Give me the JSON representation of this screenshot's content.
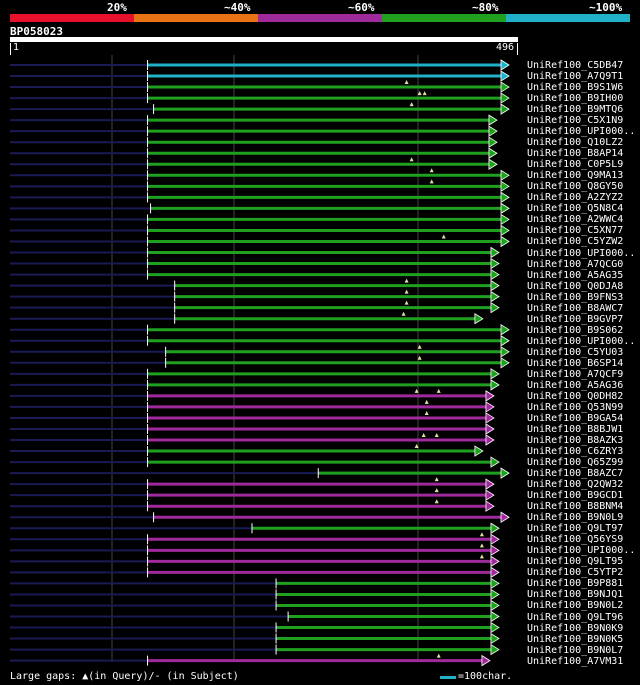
{
  "scale": {
    "segments": [
      "#e8112d",
      "#e87314",
      "#9f2a9b",
      "#1fa01f",
      "#20b0c8"
    ],
    "labels": [
      "20%",
      "~40%",
      "~60%",
      "~80%",
      "~100%"
    ]
  },
  "query": {
    "name": "BP058023",
    "start": "1",
    "end": "496",
    "length": 496
  },
  "colors": {
    "100": "#20b0c8",
    "80": "#1fa01f",
    "60": "#9f2a9b",
    "gap": "#1a1a55",
    "marker": "#e0e0a0"
  },
  "hits": [
    {
      "label": "UniRef100_C5DB47",
      "start": 137,
      "end": 496,
      "identity": "100",
      "arrow": true,
      "gaps": []
    },
    {
      "label": "UniRef100_A7Q9T1",
      "start": 137,
      "end": 496,
      "identity": "100",
      "arrow": true,
      "gaps": []
    },
    {
      "label": "UniRef100_B9S1W6",
      "start": 137,
      "end": 496,
      "identity": "80",
      "arrow": true,
      "gaps": [
        395
      ]
    },
    {
      "label": "UniRef100_B9IH00",
      "start": 137,
      "end": 496,
      "identity": "80",
      "arrow": true,
      "gaps": [
        408,
        413
      ]
    },
    {
      "label": "UniRef100_B9MTQ6",
      "start": 143,
      "end": 496,
      "identity": "80",
      "arrow": true,
      "gaps": [
        400
      ]
    },
    {
      "label": "UniRef100_C5X1N9",
      "start": 137,
      "end": 484,
      "identity": "80",
      "arrow": true,
      "gaps": []
    },
    {
      "label": "UniRef100_UPI000..",
      "start": 137,
      "end": 484,
      "identity": "80",
      "arrow": true,
      "gaps": []
    },
    {
      "label": "UniRef100_Q10LZ2",
      "start": 137,
      "end": 484,
      "identity": "80",
      "arrow": true,
      "gaps": []
    },
    {
      "label": "UniRef100_B8AP14",
      "start": 137,
      "end": 484,
      "identity": "80",
      "arrow": true,
      "gaps": []
    },
    {
      "label": "UniRef100_C0P5L9",
      "start": 137,
      "end": 484,
      "identity": "80",
      "arrow": true,
      "gaps": [
        400
      ]
    },
    {
      "label": "UniRef100_Q9MA13",
      "start": 137,
      "end": 496,
      "identity": "80",
      "arrow": true,
      "gaps": [
        420
      ]
    },
    {
      "label": "UniRef100_Q8GY50",
      "start": 137,
      "end": 496,
      "identity": "80",
      "arrow": true,
      "gaps": [
        420
      ]
    },
    {
      "label": "UniRef100_A2ZYZ2",
      "start": 137,
      "end": 496,
      "identity": "80",
      "arrow": true,
      "gaps": []
    },
    {
      "label": "UniRef100_Q5N8C4",
      "start": 140,
      "end": 496,
      "identity": "80",
      "arrow": true,
      "gaps": []
    },
    {
      "label": "UniRef100_A2WWC4",
      "start": 137,
      "end": 496,
      "identity": "80",
      "arrow": true,
      "gaps": []
    },
    {
      "label": "UniRef100_C5XN77",
      "start": 137,
      "end": 496,
      "identity": "80",
      "arrow": true,
      "gaps": []
    },
    {
      "label": "UniRef100_C5YZW2",
      "start": 137,
      "end": 496,
      "identity": "80",
      "arrow": true,
      "gaps": [
        432
      ]
    },
    {
      "label": "UniRef100_UPI000..",
      "start": 137,
      "end": 486,
      "identity": "80",
      "arrow": true,
      "gaps": []
    },
    {
      "label": "UniRef100_A7QCG0",
      "start": 137,
      "end": 486,
      "identity": "80",
      "arrow": true,
      "gaps": []
    },
    {
      "label": "UniRef100_A5AG35",
      "start": 137,
      "end": 486,
      "identity": "80",
      "arrow": true,
      "gaps": []
    },
    {
      "label": "UniRef100_Q0DJA8",
      "start": 164,
      "end": 486,
      "identity": "80",
      "arrow": true,
      "gaps": [
        395
      ]
    },
    {
      "label": "UniRef100_B9FNS3",
      "start": 164,
      "end": 486,
      "identity": "80",
      "arrow": true,
      "gaps": [
        395
      ]
    },
    {
      "label": "UniRef100_B8AWC7",
      "start": 164,
      "end": 486,
      "identity": "80",
      "arrow": true,
      "gaps": [
        395
      ]
    },
    {
      "label": "UniRef100_B9GVP7",
      "start": 164,
      "end": 470,
      "identity": "80",
      "arrow": true,
      "gaps": [
        392
      ]
    },
    {
      "label": "UniRef100_B9S062",
      "start": 137,
      "end": 496,
      "identity": "80",
      "arrow": true,
      "gaps": []
    },
    {
      "label": "UniRef100_UPI000..",
      "start": 137,
      "end": 496,
      "identity": "80",
      "arrow": true,
      "gaps": []
    },
    {
      "label": "UniRef100_C5YU03",
      "start": 155,
      "end": 496,
      "identity": "80",
      "arrow": true,
      "gaps": [
        408
      ]
    },
    {
      "label": "UniRef100_B6SP14",
      "start": 155,
      "end": 496,
      "identity": "80",
      "arrow": true,
      "gaps": [
        408
      ]
    },
    {
      "label": "UniRef100_A7QCF9",
      "start": 137,
      "end": 486,
      "identity": "80",
      "arrow": true,
      "gaps": []
    },
    {
      "label": "UniRef100_A5AG36",
      "start": 137,
      "end": 486,
      "identity": "80",
      "arrow": true,
      "gaps": []
    },
    {
      "label": "UniRef100_Q0DH82",
      "start": 137,
      "end": 481,
      "identity": "60",
      "arrow": true,
      "gaps": [
        405,
        427
      ]
    },
    {
      "label": "UniRef100_Q53N99",
      "start": 137,
      "end": 481,
      "identity": "60",
      "arrow": true,
      "gaps": [
        415
      ]
    },
    {
      "label": "UniRef100_B9GA54",
      "start": 137,
      "end": 481,
      "identity": "60",
      "arrow": true,
      "gaps": [
        415
      ]
    },
    {
      "label": "UniRef100_B8BJW1",
      "start": 137,
      "end": 481,
      "identity": "60",
      "arrow": true,
      "gaps": []
    },
    {
      "label": "UniRef100_B8AZK3",
      "start": 137,
      "end": 481,
      "identity": "60",
      "arrow": true,
      "gaps": [
        412,
        425
      ]
    },
    {
      "label": "UniRef100_C6ZRY3",
      "start": 137,
      "end": 470,
      "identity": "80",
      "arrow": true,
      "gaps": [
        405
      ]
    },
    {
      "label": "UniRef100_Q65Z99",
      "start": 137,
      "end": 486,
      "identity": "80",
      "arrow": true,
      "gaps": []
    },
    {
      "label": "UniRef100_B8AZC7",
      "start": 307,
      "end": 496,
      "identity": "80",
      "arrow": true,
      "gaps": []
    },
    {
      "label": "UniRef100_Q2QW32",
      "start": 137,
      "end": 481,
      "identity": "60",
      "arrow": true,
      "gaps": [
        425
      ]
    },
    {
      "label": "UniRef100_B9GCD1",
      "start": 137,
      "end": 481,
      "identity": "60",
      "arrow": true,
      "gaps": [
        425
      ]
    },
    {
      "label": "UniRef100_B8BNM4",
      "start": 137,
      "end": 481,
      "identity": "60",
      "arrow": true,
      "gaps": [
        425
      ]
    },
    {
      "label": "UniRef100_B9N0L9",
      "start": 143,
      "end": 496,
      "identity": "60",
      "arrow": true,
      "gaps": []
    },
    {
      "label": "UniRef100_Q9LT97",
      "start": 241,
      "end": 486,
      "identity": "80",
      "arrow": true,
      "gaps": []
    },
    {
      "label": "UniRef100_Q56YS9",
      "start": 137,
      "end": 486,
      "identity": "60",
      "arrow": true,
      "gaps": [
        470
      ]
    },
    {
      "label": "UniRef100_UPI000..",
      "start": 137,
      "end": 486,
      "identity": "60",
      "arrow": true,
      "gaps": [
        470
      ]
    },
    {
      "label": "UniRef100_Q9LT95",
      "start": 137,
      "end": 486,
      "identity": "60",
      "arrow": true,
      "gaps": [
        470
      ]
    },
    {
      "label": "UniRef100_C5YTP2",
      "start": 137,
      "end": 486,
      "identity": "60",
      "arrow": true,
      "gaps": []
    },
    {
      "label": "UniRef100_B9P881",
      "start": 265,
      "end": 486,
      "identity": "80",
      "arrow": true,
      "gaps": []
    },
    {
      "label": "UniRef100_B9NJQ1",
      "start": 265,
      "end": 486,
      "identity": "80",
      "arrow": true,
      "gaps": []
    },
    {
      "label": "UniRef100_B9N0L2",
      "start": 265,
      "end": 486,
      "identity": "80",
      "arrow": true,
      "gaps": []
    },
    {
      "label": "UniRef100_Q9LT96",
      "start": 277,
      "end": 486,
      "identity": "80",
      "arrow": true,
      "gaps": []
    },
    {
      "label": "UniRef100_B9N0K9",
      "start": 265,
      "end": 486,
      "identity": "80",
      "arrow": true,
      "gaps": []
    },
    {
      "label": "UniRef100_B9N0K5",
      "start": 265,
      "end": 486,
      "identity": "80",
      "arrow": true,
      "gaps": []
    },
    {
      "label": "UniRef100_B9N0L7",
      "start": 265,
      "end": 486,
      "identity": "80",
      "arrow": true,
      "gaps": []
    },
    {
      "label": "UniRef100_A7VM31",
      "start": 137,
      "end": 477,
      "identity": "60",
      "arrow": true,
      "gaps": [
        427
      ]
    }
  ],
  "legend": {
    "text": "Large gaps: ▲(in Query)/- (in Subject)",
    "scale_text": "=100char."
  }
}
